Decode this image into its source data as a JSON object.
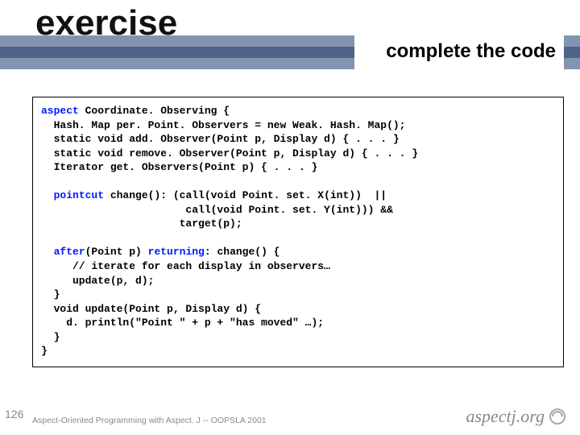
{
  "title": "exercise",
  "subtitle": "complete the code",
  "keywords": {
    "aspect": "aspect",
    "pointcut": "pointcut",
    "after": "after",
    "returning": "returning"
  },
  "code": {
    "l1a": " Coordinate. Observing {",
    "l2": "  Hash. Map per. Point. Observers = new Weak. Hash. Map();",
    "l3": "  static void add. Observer(Point p, Display d) { . . . }",
    "l4": "  static void remove. Observer(Point p, Display d) { . . . }",
    "l5": "  Iterator get. Observers(Point p) { . . . }",
    "l7a": " change(): (call(void Point. set. X(int))  ||",
    "l8": "                       call(void Point. set. Y(int))) &&",
    "l9": "                      target(p);",
    "l11a": "(Point p) ",
    "l11b": ": change() {",
    "l12": "     // iterate for each display in observers…",
    "l13": "     update(p, d);",
    "l14": "  }",
    "l15": "  void update(Point p, Display d) {",
    "l16": "    d. println(\"Point \" + p + \"has moved\" …);",
    "l17": "  }",
    "l18": "}"
  },
  "slide_number": "126",
  "footer": "Aspect-Oriented Programming with Aspect. J -- OOPSLA 2001",
  "logo_text": "aspectj.org"
}
